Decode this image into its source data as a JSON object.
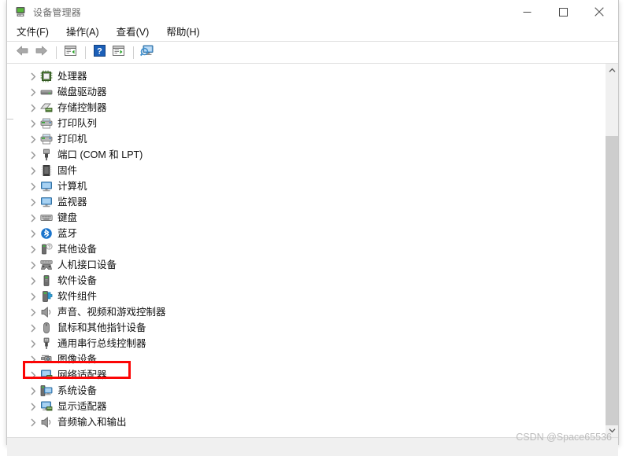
{
  "window": {
    "title": "设备管理器",
    "app_icon": "device-manager-icon",
    "controls": {
      "minimize": "最小化",
      "maximize": "最大化",
      "close": "关闭"
    }
  },
  "menubar": {
    "items": [
      {
        "label": "文件(F)",
        "name": "menu-file"
      },
      {
        "label": "操作(A)",
        "name": "menu-action"
      },
      {
        "label": "查看(V)",
        "name": "menu-view"
      },
      {
        "label": "帮助(H)",
        "name": "menu-help"
      }
    ]
  },
  "toolbar": {
    "buttons": [
      {
        "name": "back-button",
        "icon": "back-arrow-icon"
      },
      {
        "name": "forward-button",
        "icon": "forward-arrow-icon"
      },
      {
        "name": "properties-button",
        "icon": "properties-window-icon"
      },
      {
        "name": "help-button",
        "icon": "question-mark-icon"
      },
      {
        "name": "update-driver-button",
        "icon": "window-play-icon"
      },
      {
        "name": "scan-hardware-button",
        "icon": "scan-monitor-icon"
      }
    ]
  },
  "tree": {
    "items": [
      {
        "label": "处理器",
        "icon": "processor-icon"
      },
      {
        "label": "磁盘驱动器",
        "icon": "disk-drive-icon"
      },
      {
        "label": "存储控制器",
        "icon": "storage-controller-icon"
      },
      {
        "label": "打印队列",
        "icon": "print-queue-icon"
      },
      {
        "label": "打印机",
        "icon": "printer-icon"
      },
      {
        "label": "端口 (COM 和 LPT)",
        "icon": "port-icon"
      },
      {
        "label": "固件",
        "icon": "firmware-icon"
      },
      {
        "label": "计算机",
        "icon": "computer-icon"
      },
      {
        "label": "监视器",
        "icon": "monitor-icon"
      },
      {
        "label": "键盘",
        "icon": "keyboard-icon"
      },
      {
        "label": "蓝牙",
        "icon": "bluetooth-icon"
      },
      {
        "label": "其他设备",
        "icon": "other-device-icon"
      },
      {
        "label": "人机接口设备",
        "icon": "hid-gamepad-icon"
      },
      {
        "label": "软件设备",
        "icon": "software-device-icon"
      },
      {
        "label": "软件组件",
        "icon": "software-component-icon"
      },
      {
        "label": "声音、视频和游戏控制器",
        "icon": "sound-speaker-icon"
      },
      {
        "label": "鼠标和其他指针设备",
        "icon": "mouse-icon"
      },
      {
        "label": "通用串行总线控制器",
        "icon": "usb-icon"
      },
      {
        "label": "图像设备",
        "icon": "imaging-camera-icon"
      },
      {
        "label": "网络适配器",
        "icon": "network-adapter-icon",
        "highlighted": true
      },
      {
        "label": "系统设备",
        "icon": "system-device-icon"
      },
      {
        "label": "显示适配器",
        "icon": "display-adapter-icon"
      },
      {
        "label": "音频输入和输出",
        "icon": "audio-io-icon"
      }
    ],
    "expand_glyph": "›"
  },
  "annotation": {
    "highlight_color": "#fc0505",
    "target_label": "网络适配器"
  },
  "scrollbar": {
    "up_arrow": "▲",
    "down_arrow": "▼"
  },
  "watermark": {
    "text": "CSDN @Space65536"
  }
}
